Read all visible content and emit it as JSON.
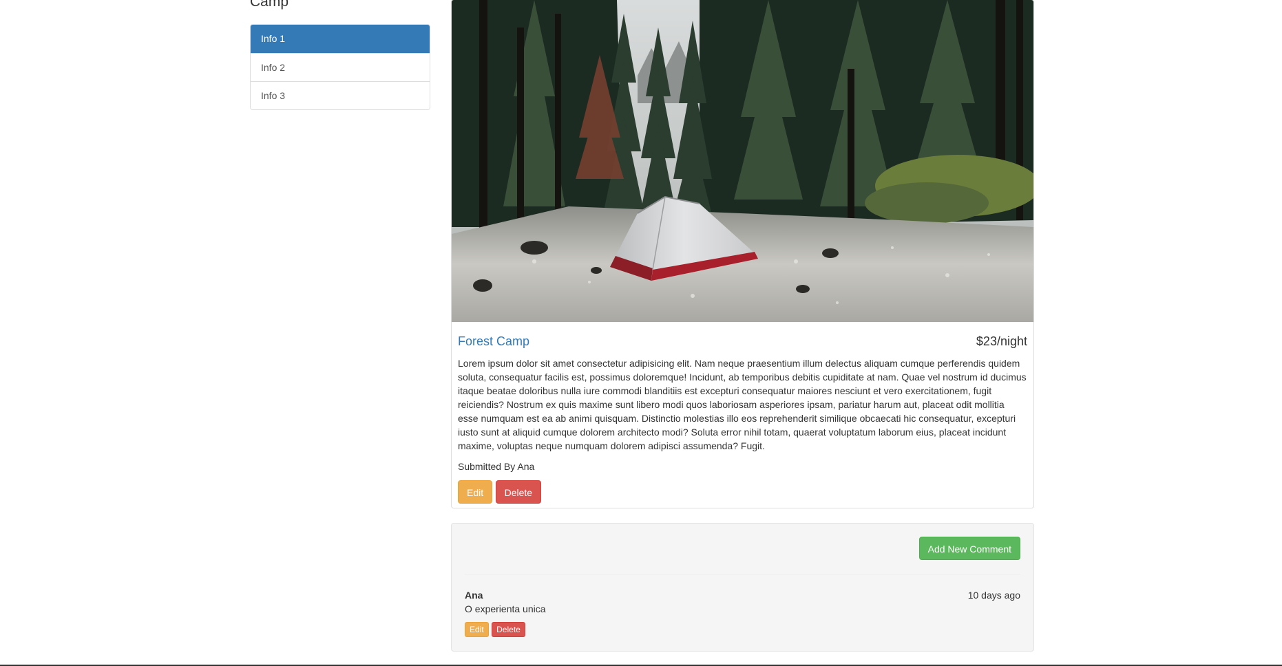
{
  "sidebar": {
    "heading": "Camp",
    "items": [
      {
        "label": "Info 1",
        "active": true
      },
      {
        "label": "Info 2",
        "active": false
      },
      {
        "label": "Info 3",
        "active": false
      }
    ]
  },
  "campground": {
    "title": "Forest Camp",
    "price": "$23/night",
    "description": "Lorem ipsum dolor sit amet consectetur adipisicing elit. Nam neque praesentium illum delectus aliquam cumque perferendis quidem soluta, consequatur facilis est, possimus doloremque! Incidunt, ab temporibus debitis cupiditate at nam. Quae vel nostrum id ducimus itaque beatae doloribus nulla iure commodi blanditiis est excepturi consequatur maiores nesciunt et vero exercitationem, fugit reiciendis? Nostrum ex quis maxime sunt libero modi quos laboriosam asperiores ipsam, pariatur harum aut, placeat odit mollitia esse numquam est ea ab animi quisquam. Distinctio molestias illo eos reprehenderit similique obcaecati hic consequatur, excepturi iusto sunt at aliquid cumque dolorem architecto modi? Soluta error nihil totam, quaerat voluptatum laborum eius, placeat incidunt maxime, voluptas neque numquam dolorem adipisci assumenda? Fugit.",
    "submitted_by": "Submitted By Ana",
    "edit_label": "Edit",
    "delete_label": "Delete"
  },
  "comments": {
    "add_label": "Add New Comment",
    "items": [
      {
        "author": "Ana",
        "time": "10 days ago",
        "text": "O experienta unica",
        "edit_label": "Edit",
        "delete_label": "Delete"
      }
    ]
  },
  "colors": {
    "primary": "#337ab7",
    "warning": "#f0ad4e",
    "danger": "#d9534f",
    "success": "#5cb85c"
  }
}
